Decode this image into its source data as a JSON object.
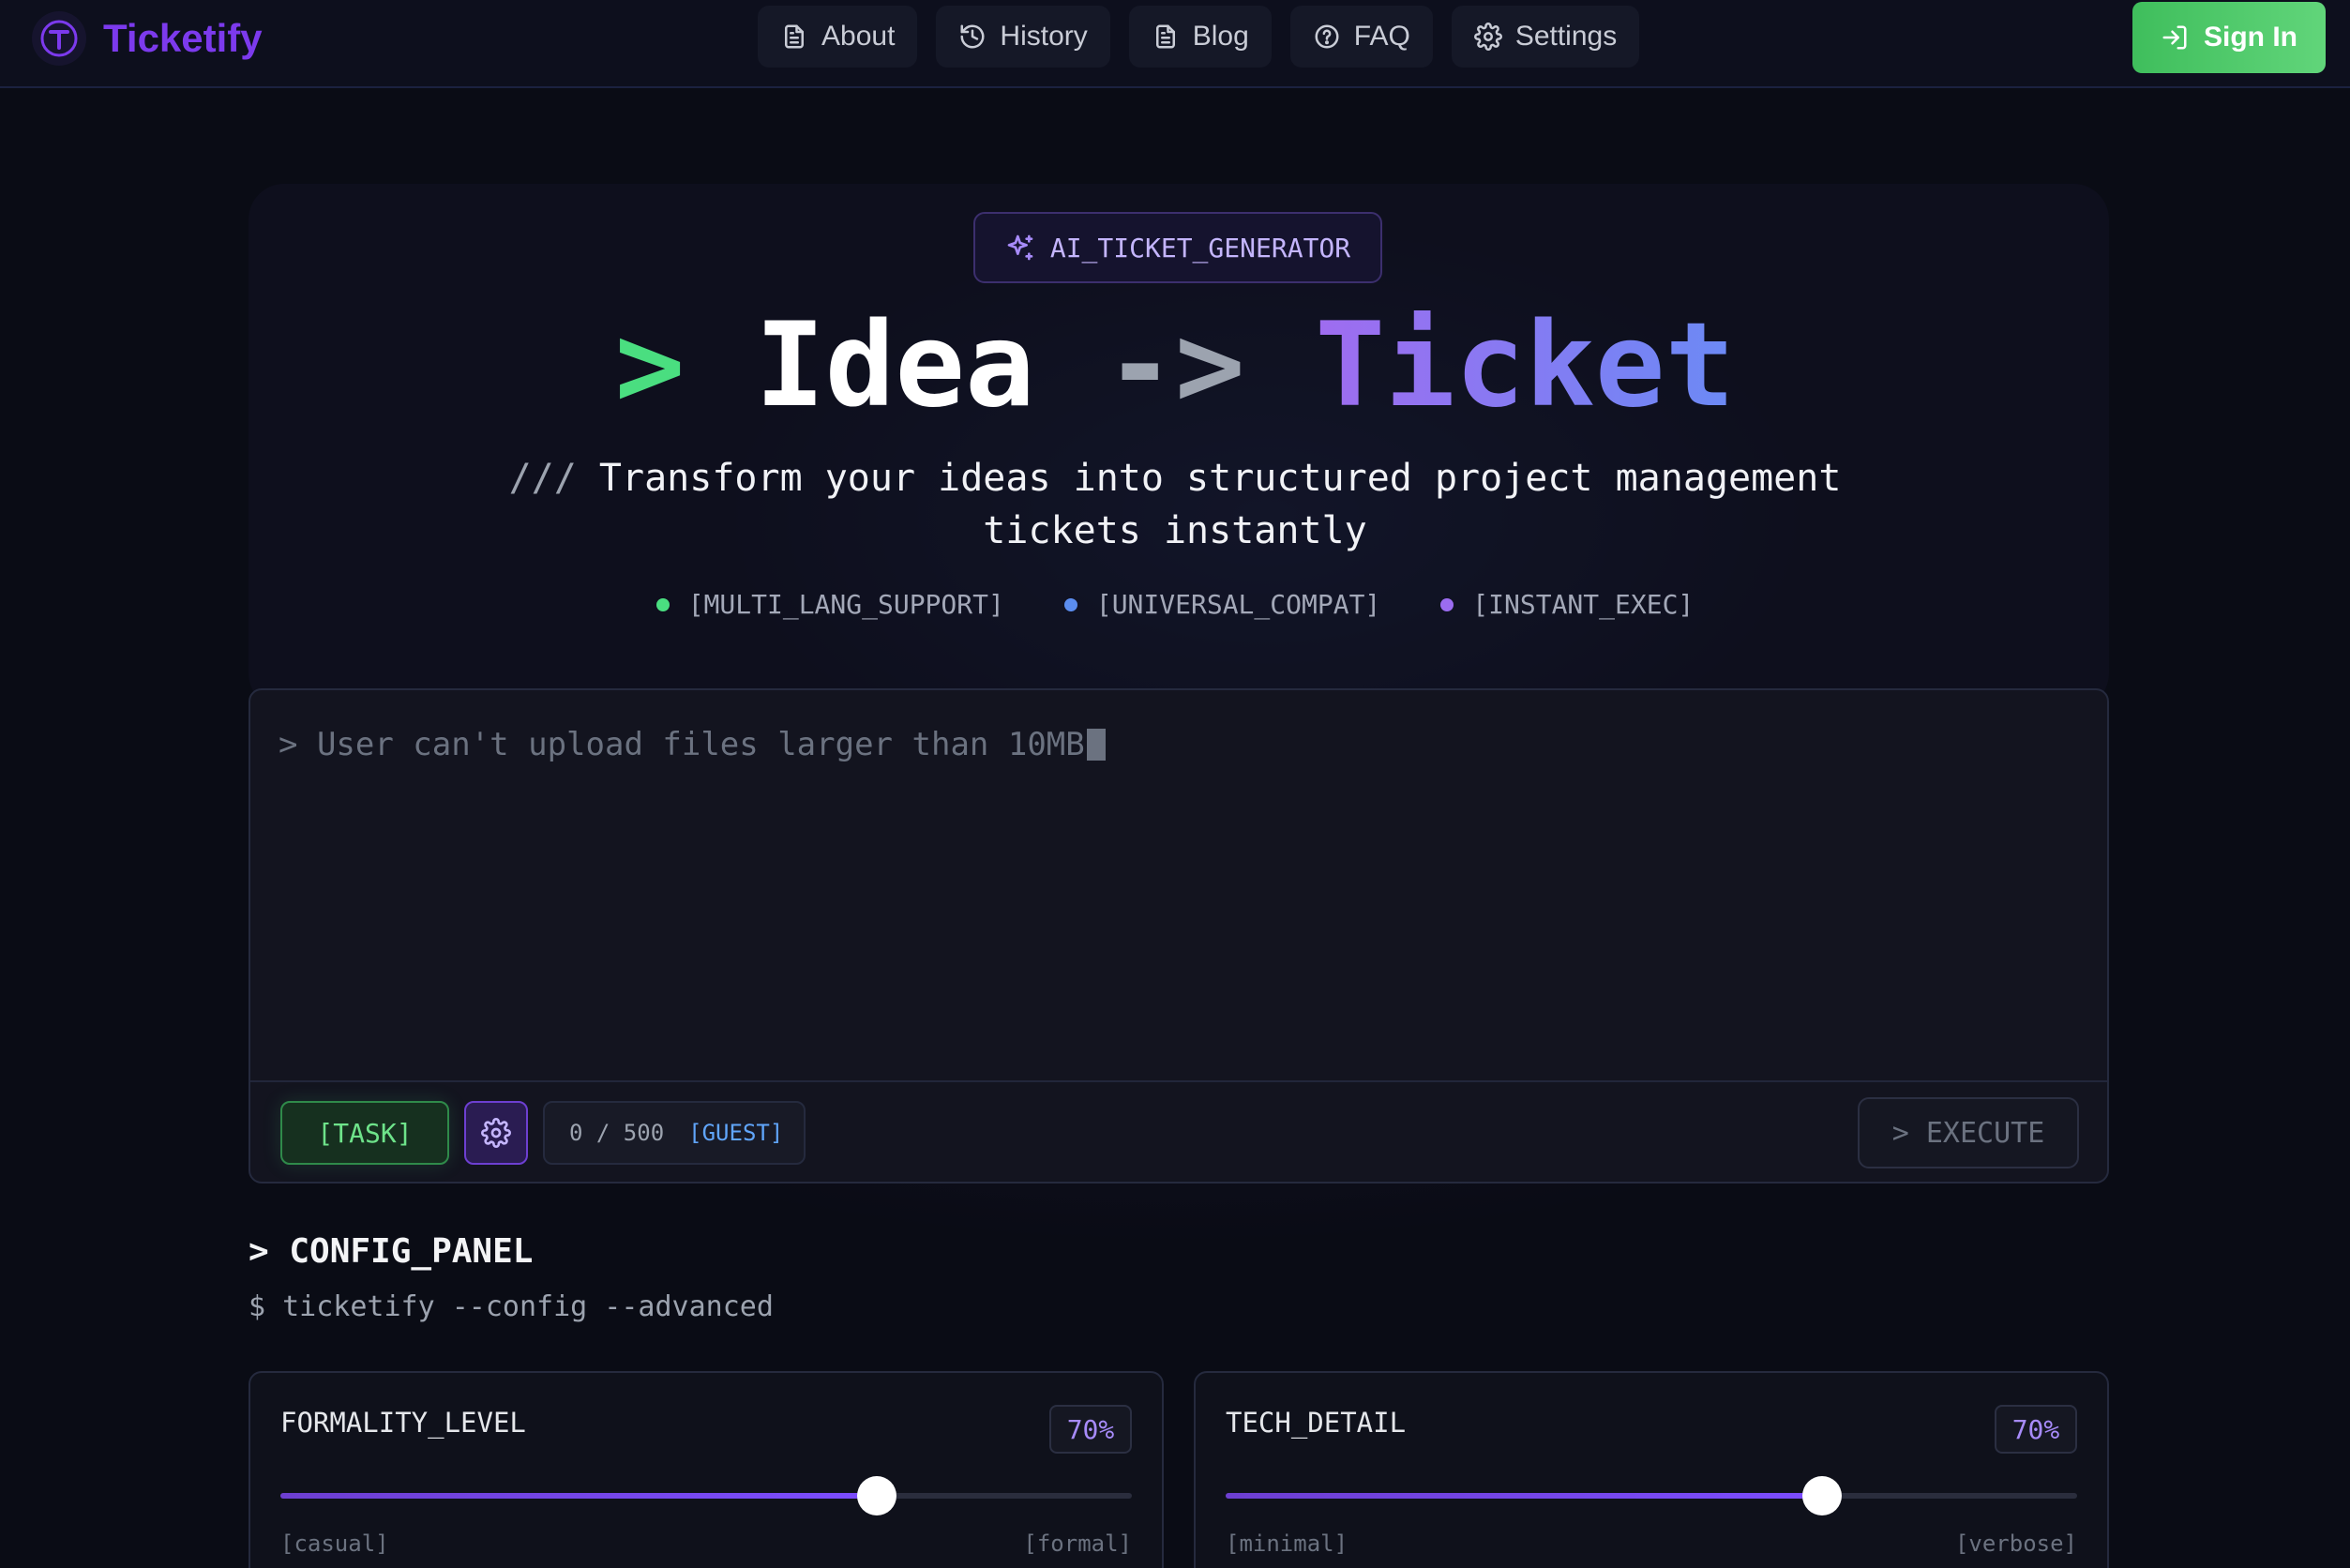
{
  "app": {
    "name": "Ticketify"
  },
  "nav": {
    "items": [
      {
        "label": "About",
        "icon": "document-icon"
      },
      {
        "label": "History",
        "icon": "history-icon"
      },
      {
        "label": "Blog",
        "icon": "document-icon"
      },
      {
        "label": "FAQ",
        "icon": "help-circle-icon"
      },
      {
        "label": "Settings",
        "icon": "gear-icon"
      }
    ],
    "signin_label": "Sign In"
  },
  "hero": {
    "badge": "AI_TICKET_GENERATOR",
    "headline": {
      "prompt": ">",
      "idea": "Idea",
      "arrow": "->",
      "ticket": "Ticket"
    },
    "subtitle_prefix": "///",
    "subtitle": "Transform your ideas into structured project management tickets instantly",
    "features": [
      {
        "label": "[MULTI_LANG_SUPPORT]",
        "color": "#4ade80"
      },
      {
        "label": "[UNIVERSAL_COMPAT]",
        "color": "#5b8def"
      },
      {
        "label": "[INSTANT_EXEC]",
        "color": "#9b6cf0"
      }
    ]
  },
  "input": {
    "placeholder": "> User can't upload files larger than 10MB",
    "type_label": "[TASK]",
    "counter": "0 / 500",
    "counter_tag": "[GUEST]",
    "execute_label": "> EXECUTE"
  },
  "config": {
    "title": "> CONFIG_PANEL",
    "command": "$ ticketify --config --advanced",
    "sliders": [
      {
        "name": "FORMALITY_LEVEL",
        "value_label": "70%",
        "value": 0.7,
        "min_label": "[casual]",
        "max_label": "[formal]"
      },
      {
        "name": "TECH_DETAIL",
        "value_label": "70%",
        "value": 0.7,
        "min_label": "[minimal]",
        "max_label": "[verbose]"
      }
    ]
  },
  "colors": {
    "brand": "#7c3aed",
    "accent_green": "#4ade80",
    "accent_blue": "#60a5fa",
    "accent_purple": "#a78bfa"
  }
}
